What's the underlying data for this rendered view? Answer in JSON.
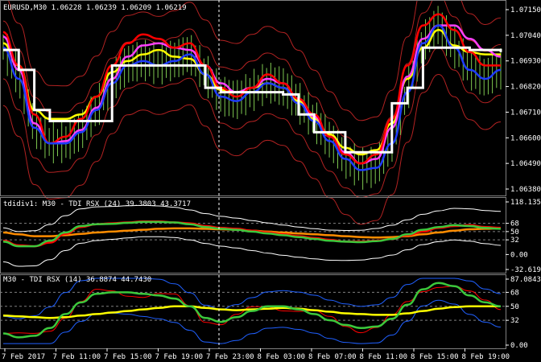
{
  "window": {
    "symbol_info": "EURUSD,M30  1.06228 1.06239 1.06209 1.06219",
    "bg": "#000000",
    "fg": "#ffffff",
    "grid": "#808080"
  },
  "price_axis": {
    "labels": [
      "1.07150",
      "1.07040",
      "1.06930",
      "1.06820",
      "1.06710",
      "1.06600",
      "1.06490",
      "1.06380"
    ]
  },
  "time_axis": {
    "labels": [
      "7 Feb 2017",
      "7 Feb 11:00",
      "7 Feb 15:00",
      "7 Feb 19:00",
      "7 Feb 23:00",
      "8 Feb 03:00",
      "8 Feb 07:00",
      "8 Feb 11:00",
      "8 Feb 15:00",
      "8 Feb 19:00"
    ]
  },
  "indicator1": {
    "label": "tdidiv1: M30 - TDI RSX (24) 39.3803 43.3717",
    "axis_labels": [
      "118.1352",
      "68",
      "50",
      "32",
      "0.00",
      "-32.6198"
    ]
  },
  "indicator2": {
    "label": "M30 - TDI RSX (14) 36.8874 44.7430",
    "axis_labels": [
      "87.0843",
      "68",
      "50",
      "32",
      "0.00"
    ]
  },
  "colors": {
    "candle": "#7ec850",
    "bb": "#b22222",
    "red": "#ff0000",
    "orange": "#ff8c00",
    "yellow": "#ffff00",
    "white": "#ffffff",
    "magenta": "#ff40ff",
    "blue": "#1e3cff",
    "cyan": "#40e0ff",
    "green": "#3cc83c",
    "blue_band": "#2060ff"
  },
  "chart_data": {
    "type": "line",
    "panes": [
      {
        "name": "price",
        "ylim": [
          1.0633,
          1.0718
        ],
        "series": [
          {
            "name": "red",
            "values": [
              1.0705,
              1.069,
              1.0668,
              1.0655,
              1.0658,
              1.0666,
              1.0676,
              1.069,
              1.07,
              1.0704,
              1.0702,
              1.0698,
              1.07,
              1.069,
              1.068,
              1.0676,
              1.068,
              1.0686,
              1.0682,
              1.0675,
              1.0668,
              1.0658,
              1.065,
              1.0646,
              1.065,
              1.0666,
              1.069,
              1.0708,
              1.0713,
              1.0706,
              1.0696,
              1.069,
              1.069
            ]
          },
          {
            "name": "magenta",
            "values": [
              1.0703,
              1.0688,
              1.0664,
              1.0655,
              1.0656,
              1.0661,
              1.0671,
              1.0684,
              1.0694,
              1.0699,
              1.07,
              1.0698,
              1.0697,
              1.069,
              1.0682,
              1.0678,
              1.068,
              1.0684,
              1.0682,
              1.0675,
              1.0667,
              1.0658,
              1.0651,
              1.0646,
              1.0648,
              1.0662,
              1.0685,
              1.0702,
              1.0708,
              1.0708,
              1.0702,
              1.0697,
              1.0694
            ]
          },
          {
            "name": "blue",
            "values": [
              1.0698,
              1.0684,
              1.0662,
              1.0655,
              1.0655,
              1.066,
              1.067,
              1.0682,
              1.069,
              1.0692,
              1.069,
              1.0692,
              1.0695,
              1.0686,
              1.0676,
              1.0674,
              1.0678,
              1.0682,
              1.068,
              1.0673,
              1.0665,
              1.0656,
              1.0648,
              1.0643,
              1.0644,
              1.0655,
              1.0678,
              1.07,
              1.0708,
              1.0698,
              1.0688,
              1.0684,
              1.0688
            ]
          },
          {
            "name": "yellow",
            "values": [
              1.07,
              1.069,
              1.067,
              1.0666,
              1.0666,
              1.0668,
              1.0676,
              1.0687,
              1.0692,
              1.0695,
              1.0697,
              1.0694,
              1.0693,
              1.0686,
              1.0679,
              1.0678,
              1.068,
              1.0682,
              1.068,
              1.0674,
              1.0666,
              1.0659,
              1.0653,
              1.065,
              1.0652,
              1.0664,
              1.0684,
              1.0698,
              1.0706,
              1.0699,
              1.0696,
              1.0695,
              1.0695
            ]
          },
          {
            "name": "white",
            "values": [
              1.0697,
              1.0688,
              1.067,
              1.0665,
              1.0665,
              1.0665,
              1.0665,
              1.069,
              1.069,
              1.069,
              1.069,
              1.069,
              1.069,
              1.068,
              1.0678,
              1.0678,
              1.0678,
              1.0678,
              1.0677,
              1.0668,
              1.066,
              1.066,
              1.0651,
              1.0651,
              1.0651,
              1.0673,
              1.068,
              1.0698,
              1.0698,
              1.0698,
              1.0697,
              1.0697,
              1.0696
            ]
          }
        ]
      },
      {
        "name": "TDI RSX (24)",
        "ylim": [
          -32.6198,
          118.1352
        ],
        "series": [
          {
            "name": "red",
            "values": [
              30,
              20,
              18,
              26,
              45,
              60,
              66,
              68,
              70,
              72,
              72,
              70,
              68,
              62,
              58,
              56,
              52,
              48,
              44,
              40,
              36,
              32,
              28,
              28,
              30,
              34,
              42,
              50,
              58,
              62,
              64,
              60,
              58
            ]
          },
          {
            "name": "green",
            "values": [
              28,
              18,
              18,
              30,
              48,
              62,
              66,
              67,
              69,
              71,
              71,
              70,
              66,
              60,
              56,
              54,
              50,
              46,
              42,
              38,
              34,
              30,
              28,
              27,
              29,
              34,
              44,
              54,
              60,
              64,
              62,
              58,
              56
            ]
          },
          {
            "name": "orange",
            "values": [
              48,
              44,
              40,
              40,
              42,
              45,
              48,
              50,
              52,
              54,
              56,
              57,
              57,
              56,
              55,
              54,
              52,
              50,
              48,
              46,
              44,
              42,
              40,
              38,
              37,
              38,
              40,
              44,
              48,
              52,
              55,
              56,
              57
            ]
          }
        ]
      },
      {
        "name": "TDI RSX (14)",
        "ylim": [
          0,
          87.0843
        ],
        "series": [
          {
            "name": "green",
            "values": [
              15,
              10,
              12,
              22,
              40,
              55,
              66,
              68,
              68,
              66,
              64,
              60,
              50,
              35,
              30,
              36,
              44,
              50,
              50,
              46,
              40,
              32,
              26,
              22,
              24,
              34,
              52,
              72,
              80,
              76,
              64,
              55,
              50
            ]
          },
          {
            "name": "yellow",
            "values": [
              38,
              37,
              36,
              35,
              36,
              38,
              40,
              42,
              44,
              46,
              48,
              50,
              50,
              48,
              46,
              45,
              46,
              47,
              48,
              47,
              45,
              43,
              41,
              40,
              39,
              39,
              41,
              44,
              47,
              49,
              50,
              50,
              50
            ]
          }
        ]
      }
    ]
  }
}
